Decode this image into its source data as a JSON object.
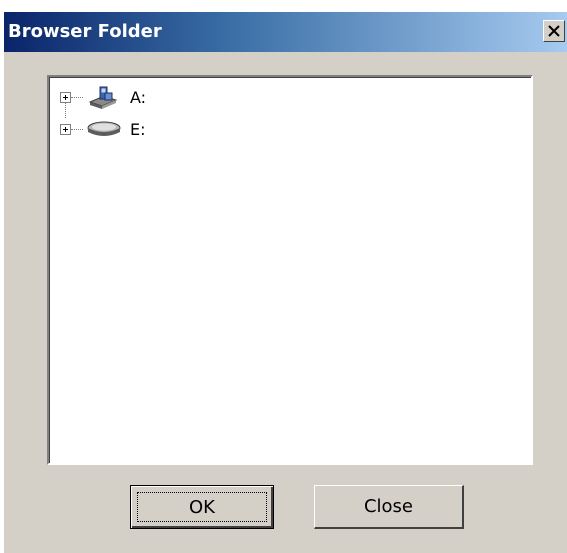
{
  "window": {
    "title": "Browser Folder",
    "close_glyph": "close-icon"
  },
  "tree": {
    "items": [
      {
        "label": "A:",
        "icon": "floppy-drive-icon",
        "expander": "plus-icon"
      },
      {
        "label": "E:",
        "icon": "hard-drive-icon",
        "expander": "plus-icon"
      }
    ]
  },
  "buttons": {
    "ok_label": "OK",
    "close_label": "Close"
  },
  "colors": {
    "title_start": "#0a246a",
    "title_end": "#a6caf0",
    "face": "#d4d0c8"
  }
}
